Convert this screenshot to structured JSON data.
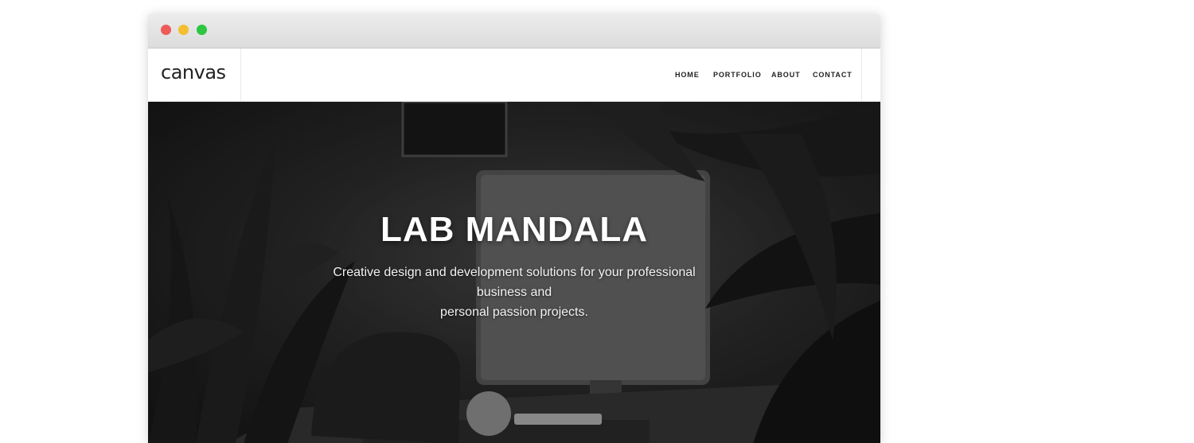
{
  "site": {
    "logo": "canvas",
    "nav": [
      {
        "label": "HOME"
      },
      {
        "label": "PORTFOLIO"
      },
      {
        "label": "ABOUT"
      },
      {
        "label": "CONTACT"
      }
    ]
  },
  "hero": {
    "title": "LAB MANDALA",
    "subtitle_line1": "Creative design and development solutions for your professional business and",
    "subtitle_line2": "personal passion projects."
  },
  "window_controls": [
    "close-dot",
    "minimize-dot",
    "maximize-dot"
  ],
  "colors": {
    "close": "#ee5b58",
    "minimize": "#f4be2f",
    "maximize": "#2cc640",
    "nav_text": "#222222",
    "hero_text": "#ffffff"
  }
}
